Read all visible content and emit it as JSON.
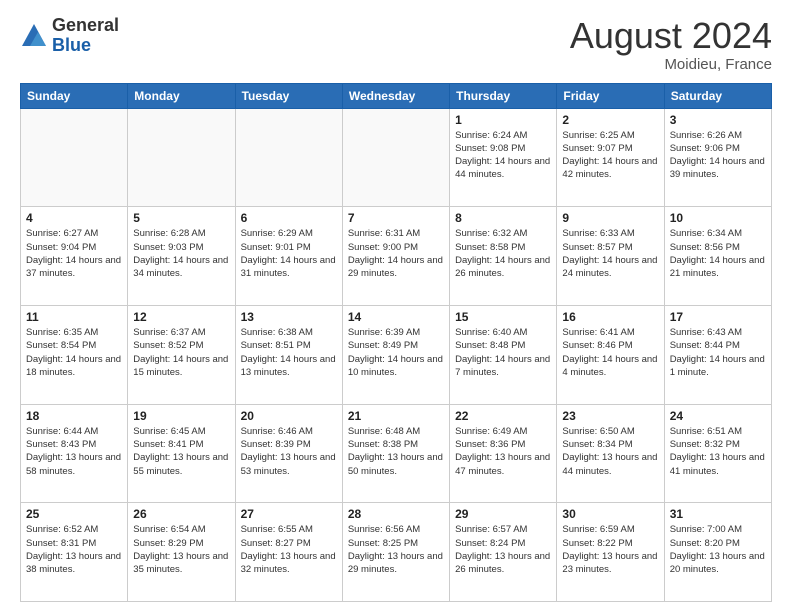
{
  "logo": {
    "general": "General",
    "blue": "Blue"
  },
  "title": "August 2024",
  "location": "Moidieu, France",
  "days_header": [
    "Sunday",
    "Monday",
    "Tuesday",
    "Wednesday",
    "Thursday",
    "Friday",
    "Saturday"
  ],
  "weeks": [
    [
      {
        "day": "",
        "info": ""
      },
      {
        "day": "",
        "info": ""
      },
      {
        "day": "",
        "info": ""
      },
      {
        "day": "",
        "info": ""
      },
      {
        "day": "1",
        "info": "Sunrise: 6:24 AM\nSunset: 9:08 PM\nDaylight: 14 hours\nand 44 minutes."
      },
      {
        "day": "2",
        "info": "Sunrise: 6:25 AM\nSunset: 9:07 PM\nDaylight: 14 hours\nand 42 minutes."
      },
      {
        "day": "3",
        "info": "Sunrise: 6:26 AM\nSunset: 9:06 PM\nDaylight: 14 hours\nand 39 minutes."
      }
    ],
    [
      {
        "day": "4",
        "info": "Sunrise: 6:27 AM\nSunset: 9:04 PM\nDaylight: 14 hours\nand 37 minutes."
      },
      {
        "day": "5",
        "info": "Sunrise: 6:28 AM\nSunset: 9:03 PM\nDaylight: 14 hours\nand 34 minutes."
      },
      {
        "day": "6",
        "info": "Sunrise: 6:29 AM\nSunset: 9:01 PM\nDaylight: 14 hours\nand 31 minutes."
      },
      {
        "day": "7",
        "info": "Sunrise: 6:31 AM\nSunset: 9:00 PM\nDaylight: 14 hours\nand 29 minutes."
      },
      {
        "day": "8",
        "info": "Sunrise: 6:32 AM\nSunset: 8:58 PM\nDaylight: 14 hours\nand 26 minutes."
      },
      {
        "day": "9",
        "info": "Sunrise: 6:33 AM\nSunset: 8:57 PM\nDaylight: 14 hours\nand 24 minutes."
      },
      {
        "day": "10",
        "info": "Sunrise: 6:34 AM\nSunset: 8:56 PM\nDaylight: 14 hours\nand 21 minutes."
      }
    ],
    [
      {
        "day": "11",
        "info": "Sunrise: 6:35 AM\nSunset: 8:54 PM\nDaylight: 14 hours\nand 18 minutes."
      },
      {
        "day": "12",
        "info": "Sunrise: 6:37 AM\nSunset: 8:52 PM\nDaylight: 14 hours\nand 15 minutes."
      },
      {
        "day": "13",
        "info": "Sunrise: 6:38 AM\nSunset: 8:51 PM\nDaylight: 14 hours\nand 13 minutes."
      },
      {
        "day": "14",
        "info": "Sunrise: 6:39 AM\nSunset: 8:49 PM\nDaylight: 14 hours\nand 10 minutes."
      },
      {
        "day": "15",
        "info": "Sunrise: 6:40 AM\nSunset: 8:48 PM\nDaylight: 14 hours\nand 7 minutes."
      },
      {
        "day": "16",
        "info": "Sunrise: 6:41 AM\nSunset: 8:46 PM\nDaylight: 14 hours\nand 4 minutes."
      },
      {
        "day": "17",
        "info": "Sunrise: 6:43 AM\nSunset: 8:44 PM\nDaylight: 14 hours\nand 1 minute."
      }
    ],
    [
      {
        "day": "18",
        "info": "Sunrise: 6:44 AM\nSunset: 8:43 PM\nDaylight: 13 hours\nand 58 minutes."
      },
      {
        "day": "19",
        "info": "Sunrise: 6:45 AM\nSunset: 8:41 PM\nDaylight: 13 hours\nand 55 minutes."
      },
      {
        "day": "20",
        "info": "Sunrise: 6:46 AM\nSunset: 8:39 PM\nDaylight: 13 hours\nand 53 minutes."
      },
      {
        "day": "21",
        "info": "Sunrise: 6:48 AM\nSunset: 8:38 PM\nDaylight: 13 hours\nand 50 minutes."
      },
      {
        "day": "22",
        "info": "Sunrise: 6:49 AM\nSunset: 8:36 PM\nDaylight: 13 hours\nand 47 minutes."
      },
      {
        "day": "23",
        "info": "Sunrise: 6:50 AM\nSunset: 8:34 PM\nDaylight: 13 hours\nand 44 minutes."
      },
      {
        "day": "24",
        "info": "Sunrise: 6:51 AM\nSunset: 8:32 PM\nDaylight: 13 hours\nand 41 minutes."
      }
    ],
    [
      {
        "day": "25",
        "info": "Sunrise: 6:52 AM\nSunset: 8:31 PM\nDaylight: 13 hours\nand 38 minutes."
      },
      {
        "day": "26",
        "info": "Sunrise: 6:54 AM\nSunset: 8:29 PM\nDaylight: 13 hours\nand 35 minutes."
      },
      {
        "day": "27",
        "info": "Sunrise: 6:55 AM\nSunset: 8:27 PM\nDaylight: 13 hours\nand 32 minutes."
      },
      {
        "day": "28",
        "info": "Sunrise: 6:56 AM\nSunset: 8:25 PM\nDaylight: 13 hours\nand 29 minutes."
      },
      {
        "day": "29",
        "info": "Sunrise: 6:57 AM\nSunset: 8:24 PM\nDaylight: 13 hours\nand 26 minutes."
      },
      {
        "day": "30",
        "info": "Sunrise: 6:59 AM\nSunset: 8:22 PM\nDaylight: 13 hours\nand 23 minutes."
      },
      {
        "day": "31",
        "info": "Sunrise: 7:00 AM\nSunset: 8:20 PM\nDaylight: 13 hours\nand 20 minutes."
      }
    ]
  ]
}
